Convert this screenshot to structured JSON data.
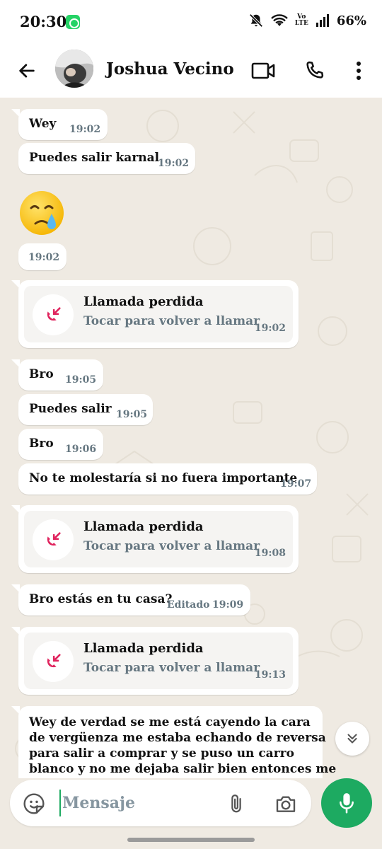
{
  "status_bar": {
    "time": "20:30",
    "battery": "66%",
    "volte_top": "Vo",
    "volte_bottom": "LTE",
    "icons": [
      "whatsapp-notification-icon",
      "bell-off-icon",
      "wifi-icon",
      "volte-icon",
      "signal-icon"
    ]
  },
  "header": {
    "contact_name": "Joshua Vecino",
    "icons": [
      "back-arrow-icon",
      "video-call-icon",
      "voice-call-icon",
      "more-options-icon"
    ]
  },
  "messages": [
    {
      "type": "text",
      "text": "Wey",
      "time": "19:02"
    },
    {
      "type": "text",
      "text": "Puedes salir karnal",
      "time": "19:02"
    },
    {
      "type": "emoji",
      "emoji": "crying-face",
      "time": "19:02"
    },
    {
      "type": "missed_call",
      "title": "Llamada perdida",
      "subtitle": "Tocar para volver a llamar",
      "time": "19:02"
    },
    {
      "type": "text",
      "text": "Bro",
      "time": "19:05"
    },
    {
      "type": "text",
      "text": "Puedes salir",
      "time": "19:05"
    },
    {
      "type": "text",
      "text": "Bro",
      "time": "19:06"
    },
    {
      "type": "text",
      "text": "No te molestaría si no fuera importante",
      "time": "19:07"
    },
    {
      "type": "missed_call",
      "title": "Llamada perdida",
      "subtitle": "Tocar para volver a llamar",
      "time": "19:08"
    },
    {
      "type": "text",
      "text": "Bro estás en tu casa?",
      "edited_label": "Editado",
      "time": "19:09"
    },
    {
      "type": "missed_call",
      "title": "Llamada perdida",
      "subtitle": "Tocar para volver a llamar",
      "time": "19:13"
    },
    {
      "type": "text_long",
      "lines": [
        "Wey de verdad se me está cayendo la cara",
        "de vergüenza me estaba echando de reversa",
        "para salir a comprar y se puso un carro",
        "blanco y no me dejaba salir bien entonces me"
      ]
    }
  ],
  "input": {
    "placeholder": "Mensaje"
  },
  "colors": {
    "chat_background": "#efeae2",
    "bubble": "#ffffff",
    "missed_call_red": "#e0245e",
    "accent_green": "#1daa61",
    "meta_gray": "#667781"
  }
}
